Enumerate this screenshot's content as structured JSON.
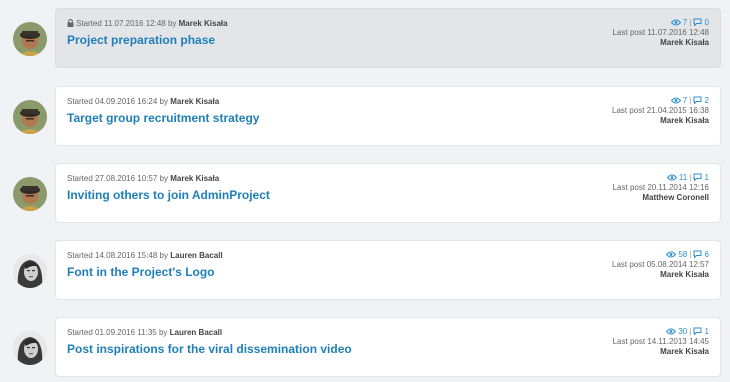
{
  "threads": [
    {
      "started_prefix": "Started",
      "started_date": "11.07.2016 12:48",
      "by": "by",
      "author": "Marek Kisała",
      "title": "Project preparation phase",
      "views": "7",
      "replies": "0",
      "last_post_prefix": "Last post",
      "last_post_date": "11.07.2016 12:48",
      "last_post_author": "Marek Kisała",
      "locked": true,
      "avatar": "man-with-cap-avatar"
    },
    {
      "started_prefix": "Started",
      "started_date": "04.09.2016 16:24",
      "by": "by",
      "author": "Marek Kisała",
      "title": "Target group recruitment strategy",
      "views": "7",
      "replies": "2",
      "last_post_prefix": "Last post",
      "last_post_date": "21.04.2015 16:38",
      "last_post_author": "Marek Kisała",
      "locked": false,
      "avatar": "man-with-cap-avatar"
    },
    {
      "started_prefix": "Started",
      "started_date": "27.08.2016 10:57",
      "by": "by",
      "author": "Marek Kisała",
      "title": "Inviting others to join AdminProject",
      "views": "11",
      "replies": "1",
      "last_post_prefix": "Last post",
      "last_post_date": "20.11.2014 12:16",
      "last_post_author": "Matthew Coronell",
      "locked": false,
      "avatar": "man-with-cap-avatar"
    },
    {
      "started_prefix": "Started",
      "started_date": "14.08.2016 15:48",
      "by": "by",
      "author": "Lauren Bacall",
      "title": "Font in the Project's Logo",
      "views": "58",
      "replies": "6",
      "last_post_prefix": "Last post",
      "last_post_date": "05.08.2014 12:57",
      "last_post_author": "Marek Kisała",
      "locked": false,
      "avatar": "woman-bw-avatar"
    },
    {
      "started_prefix": "Started",
      "started_date": "01.09.2016 11:35",
      "by": "by",
      "author": "Lauren Bacall",
      "title": "Post inspirations for the viral dissemination video",
      "views": "30",
      "replies": "1",
      "last_post_prefix": "Last post",
      "last_post_date": "14.11.2013 14:45",
      "last_post_author": "Marek Kisała",
      "locked": false,
      "avatar": "woman-bw-avatar"
    }
  ],
  "colors": {
    "page_background": "#f1f2f5",
    "card_background": "#ffffff",
    "locked_card_background": "#e4e5e8",
    "title_link": "#1f7fb8",
    "count_icon": "#2d8fd0"
  },
  "icons": {
    "lock": "lock-icon",
    "views": "eye-icon",
    "replies": "comment-icon"
  }
}
